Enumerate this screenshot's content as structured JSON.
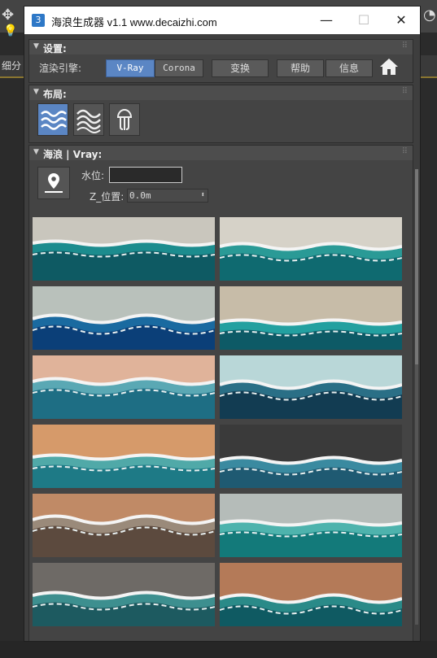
{
  "host": {
    "left_label": "细分"
  },
  "window": {
    "app_icon": "3",
    "title": "海浪生成器 v1.1 www.decaizhi.com",
    "controls": [
      "—",
      "☐",
      "✕"
    ]
  },
  "settings": {
    "title": "设置:",
    "engine_label": "渲染引擎:",
    "engines": [
      "V-Ray",
      "Corona"
    ],
    "active_engine": "V-Ray",
    "buttons": {
      "swap": "变换",
      "help": "帮助",
      "info": "信息"
    }
  },
  "layout": {
    "title": "布局:"
  },
  "waves": {
    "title": "海浪 | Vray:",
    "water_label": "水位:",
    "water_value": "",
    "z_label": "Z_位置:",
    "z_value": "0.0m"
  },
  "thumbnails": [
    {
      "sand": "#c9c6bd",
      "deep": "#0e5a63",
      "mid": "#1c8c8e"
    },
    {
      "sand": "#d6d2c8",
      "deep": "#0f6a70",
      "mid": "#2a9a96"
    },
    {
      "sand": "#b9c1bb",
      "deep": "#0b3f78",
      "mid": "#1a6aa0"
    },
    {
      "sand": "#c7bca8",
      "deep": "#0d5a66",
      "mid": "#23a0a0"
    },
    {
      "sand": "#e0b39a",
      "deep": "#1e6e84",
      "mid": "#5aa8b4"
    },
    {
      "sand": "#b9d7d8",
      "deep": "#123c52",
      "mid": "#2a6f86"
    },
    {
      "sand": "#d69a6a",
      "deep": "#1e7a86",
      "mid": "#50a9a8"
    },
    {
      "sand": "#3a3a3a",
      "deep": "#1f5a72",
      "mid": "#3a8aa0"
    },
    {
      "sand": "#c08a66",
      "deep": "#5c4a3e",
      "mid": "#9a8a7a"
    },
    {
      "sand": "#b5bcb9",
      "deep": "#137a7a",
      "mid": "#4eb3ad"
    },
    {
      "sand": "#6e6a66",
      "deep": "#1d5a60",
      "mid": "#3d8f8f"
    },
    {
      "sand": "#b47a58",
      "deep": "#0f5a62",
      "mid": "#2a8a88"
    }
  ],
  "colors": {
    "accent": "#5b86c4",
    "panel": "#444444",
    "window_bg": "#3e3e3e"
  }
}
